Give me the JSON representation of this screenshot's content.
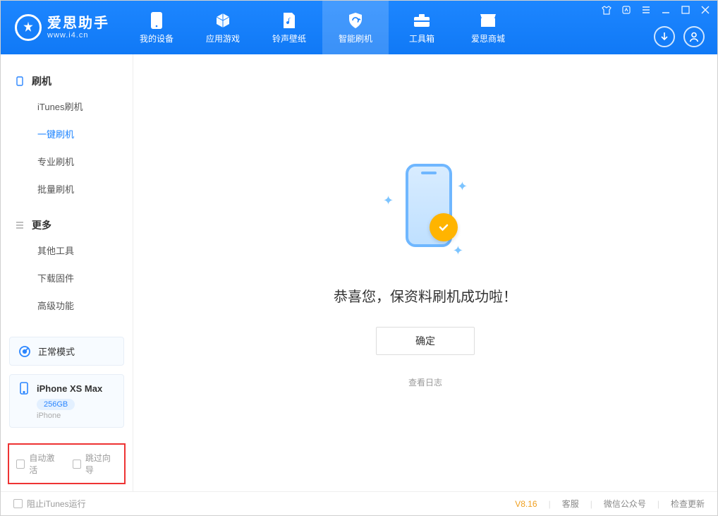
{
  "brand": {
    "name": "爱思助手",
    "site": "www.i4.cn"
  },
  "tabs": {
    "device": "我的设备",
    "apps": "应用游戏",
    "ring": "铃声壁纸",
    "flash": "智能刷机",
    "tools": "工具箱",
    "store": "爱思商城"
  },
  "sidebar": {
    "group_flash": "刷机",
    "items_flash": [
      "iTunes刷机",
      "一键刷机",
      "专业刷机",
      "批量刷机"
    ],
    "active_flash_index": 1,
    "group_more": "更多",
    "items_more": [
      "其他工具",
      "下载固件",
      "高级功能"
    ]
  },
  "mode": {
    "label": "正常模式"
  },
  "device": {
    "name": "iPhone XS Max",
    "storage": "256GB",
    "type": "iPhone"
  },
  "options": {
    "auto_activate": "自动激活",
    "skip_guide": "跳过向导"
  },
  "main": {
    "success_text": "恭喜您，保资料刷机成功啦！",
    "ok": "确定",
    "view_log": "查看日志"
  },
  "footer": {
    "block_itunes": "阻止iTunes运行",
    "version": "V8.16",
    "support": "客服",
    "wechat": "微信公众号",
    "update": "检查更新"
  }
}
